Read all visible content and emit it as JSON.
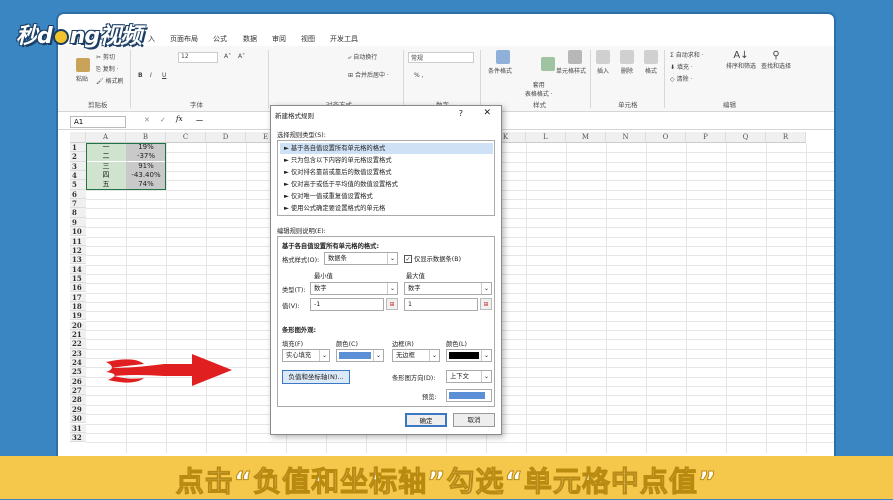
{
  "logo": {
    "text_before": "秒",
    "text_mid": "d",
    "text_after": "ng视频"
  },
  "ribbon": {
    "tabs": [
      "入",
      "页面布局",
      "公式",
      "数据",
      "审阅",
      "视图",
      "开发工具"
    ],
    "clipboard": {
      "cut": "剪切",
      "copy": "复制 ·",
      "paste": "粘贴",
      "format_painter": "格式刷",
      "group": "剪贴板"
    },
    "font": {
      "size": "12",
      "bold": "B",
      "italic": "I",
      "underline": "U",
      "grow": "A˄",
      "shrink": "A˅",
      "group": "字体"
    },
    "alignment": {
      "wrap": "自动换行",
      "merge": "合并后居中 ·",
      "group": "对齐方式"
    },
    "number": {
      "format": "常规",
      "percent": "% ,",
      "group": "数字"
    },
    "styles": {
      "conditional": "条件格式",
      "table": "套用\n表格格式 ·",
      "cell": "单元格样式",
      "group": "样式"
    },
    "cells": {
      "insert": "插入",
      "delete": "删除",
      "format": "格式",
      "group": "单元格"
    },
    "editing": {
      "autosum": "自动求和 ·",
      "fill": "填充 ·",
      "clear": "清除 ·",
      "sort": "排序和筛选",
      "find": "查找和选择",
      "group": "编辑"
    }
  },
  "formula_bar": {
    "name_box": "A1",
    "fx": "fx",
    "value": "一"
  },
  "grid": {
    "columns": [
      "A",
      "B",
      "C",
      "D",
      "E",
      "F",
      "G",
      "H",
      "I",
      "J",
      "K",
      "L",
      "M",
      "N",
      "O",
      "P",
      "Q",
      "R"
    ],
    "rows": [
      "1",
      "2",
      "3",
      "4",
      "5",
      "6",
      "7",
      "8",
      "9",
      "10",
      "11",
      "12",
      "13",
      "14",
      "15",
      "16",
      "17",
      "18",
      "19",
      "20",
      "21",
      "22",
      "23",
      "24",
      "25",
      "26",
      "27",
      "28",
      "29",
      "30",
      "31",
      "32"
    ],
    "data": [
      {
        "a": "一",
        "b": "19%"
      },
      {
        "a": "二",
        "b": "-37%"
      },
      {
        "a": "三",
        "b": "91%"
      },
      {
        "a": "四",
        "b": "-43.40%"
      },
      {
        "a": "五",
        "b": "74%"
      }
    ]
  },
  "dialog": {
    "title": "新建格式规则",
    "help": "?",
    "close": "✕",
    "rule_type_label": "选择规则类型(S):",
    "rules": [
      "► 基于各自值设置所有单元格的格式",
      "► 只为包含以下内容的单元格设置格式",
      "► 仅对排名靠前或靠后的数值设置格式",
      "► 仅对高于或低于平均值的数值设置格式",
      "► 仅对唯一值或重复值设置格式",
      "► 使用公式确定要设置格式的单元格"
    ],
    "edit_label": "编辑规则说明(E):",
    "edit_heading": "基于各自值设置所有单元格的格式:",
    "format_style_label": "格式样式(O):",
    "format_style_value": "数据条",
    "show_bar_only": "仅显示数据条(B)",
    "min_label": "最小值",
    "max_label": "最大值",
    "type_label": "类型(T):",
    "min_type": "数字",
    "max_type": "数字",
    "value_label": "值(V):",
    "min_value": "-1",
    "max_value": "1",
    "bar_appearance": "条形图外观:",
    "fill_label": "填充(F)",
    "fill_value": "实心填充",
    "color_label": "颜色(C)",
    "border_label": "边框(R)",
    "border_value": "无边框",
    "border_color_label": "颜色(L)",
    "negative_button": "负值和坐标轴(N)...",
    "direction_label": "条形图方向(D):",
    "direction_value": "上下文",
    "preview_label": "预览:",
    "ok": "确定",
    "cancel": "取消"
  },
  "caption": "点击“负值和坐标轴”勾选“单元格中点值”",
  "colors": {
    "bar_fill": "#5b8fd6",
    "border_color": "#000000",
    "arrow": "#e02020",
    "caption_bg": "#f5c74a",
    "outer_bg": "#3a86c2"
  }
}
